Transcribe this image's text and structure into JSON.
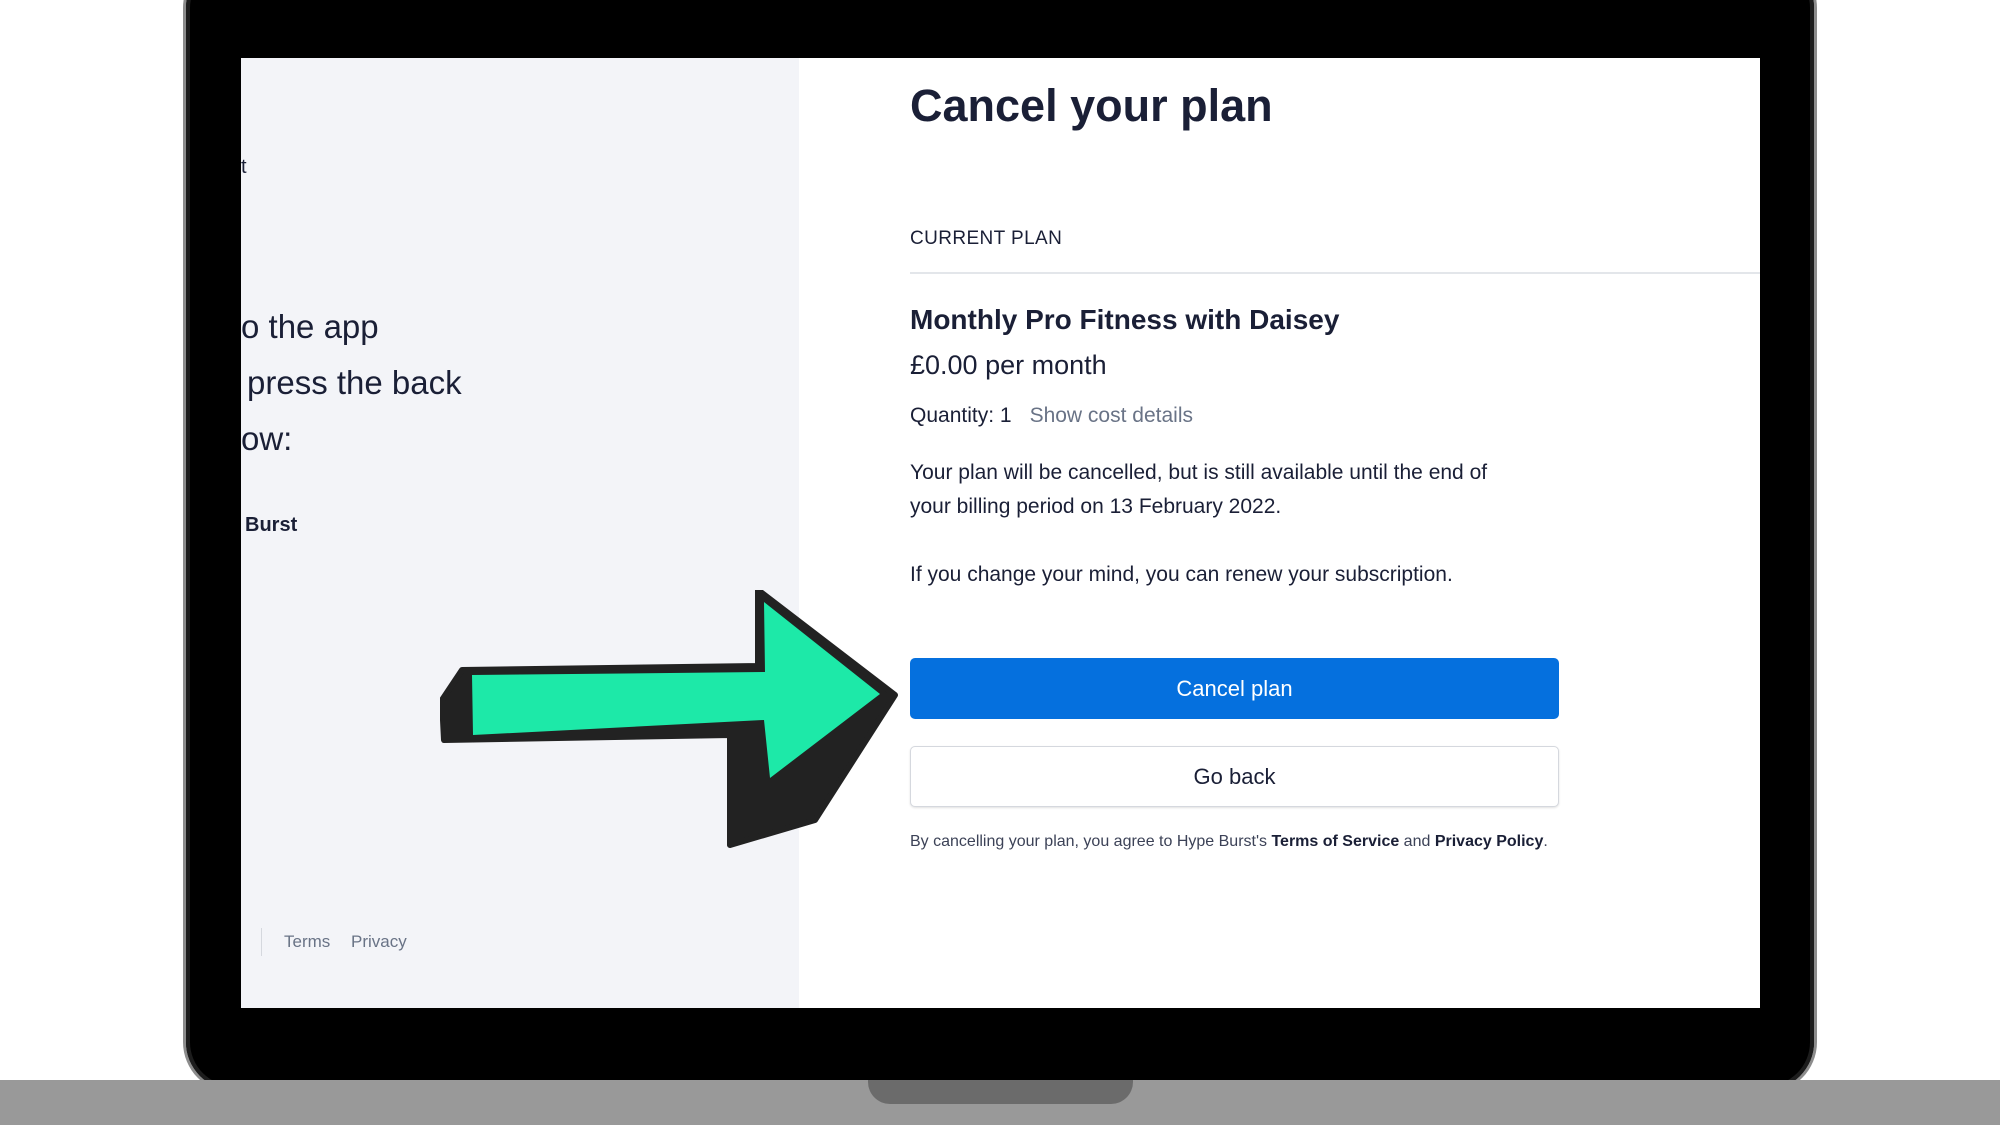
{
  "left_pane": {
    "fragment_1": "t",
    "fragment_2": "o the app",
    "fragment_3": "press the back",
    "fragment_4": "ow:",
    "fragment_5": "Burst",
    "footer_terms": "Terms",
    "footer_privacy": "Privacy"
  },
  "main": {
    "title": "Cancel your plan",
    "section_label": "CURRENT PLAN",
    "plan_name": "Monthly Pro Fitness with Daisey",
    "plan_price": "£0.00 per month",
    "quantity_label": "Quantity: 1",
    "cost_details_link": "Show cost details",
    "notice_line_1": "Your plan will be cancelled, but is still available until the end of",
    "notice_line_2": "your billing period on 13 February 2022.",
    "renew_text": "If you change your mind, you can renew your subscription.",
    "cancel_button": "Cancel plan",
    "back_button": "Go back",
    "legal_prefix": "By cancelling your plan, you agree to Hype Burst's ",
    "legal_terms": "Terms of Service",
    "legal_and": " and ",
    "legal_privacy": "Privacy Policy",
    "legal_suffix": "."
  },
  "colors": {
    "primary_button": "#0570de",
    "arrow_fill": "#1de9a8",
    "arrow_outline": "#222222",
    "left_pane_bg": "#f3f4f8"
  },
  "icons": {
    "annotation": "arrow-right-icon"
  }
}
